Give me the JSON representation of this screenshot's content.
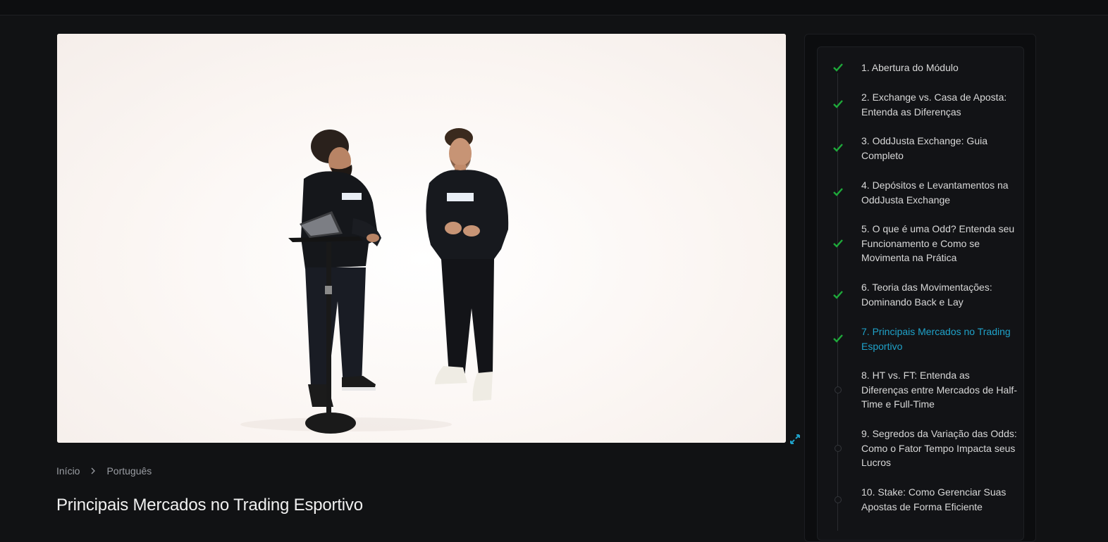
{
  "breadcrumb": {
    "home": "Início",
    "current": "Português"
  },
  "page_title": "Principais Mercados no Trading Esportivo",
  "video": {
    "hoodie_brand": "ODDJUSTA"
  },
  "lessons": [
    {
      "label": "1. Abertura do Módulo",
      "status": "completed"
    },
    {
      "label": "2. Exchange vs. Casa de Aposta: Entenda as Diferenças",
      "status": "completed"
    },
    {
      "label": "3. OddJusta Exchange: Guia Completo",
      "status": "completed"
    },
    {
      "label": "4. Depósitos e Levantamentos na OddJusta Exchange",
      "status": "completed"
    },
    {
      "label": "5. O que é uma Odd? Entenda seu Funcionamento e Como se Movimenta na Prática",
      "status": "completed"
    },
    {
      "label": "6. Teoria das Movimentações: Dominando Back e Lay",
      "status": "completed"
    },
    {
      "label": "7. Principais Mercados no Trading Esportivo",
      "status": "current"
    },
    {
      "label": "8. HT vs. FT: Entenda as Diferenças entre Mercados de Half-Time e Full-Time",
      "status": "pending"
    },
    {
      "label": "9. Segredos da Variação das Odds: Como o Fator Tempo Impacta seus Lucros",
      "status": "pending"
    },
    {
      "label": "10. Stake: Como Gerenciar Suas Apostas de Forma Eficiente",
      "status": "pending"
    }
  ],
  "colors": {
    "accent": "#1fa2c9",
    "check": "#1ea93a",
    "background": "#111214"
  }
}
